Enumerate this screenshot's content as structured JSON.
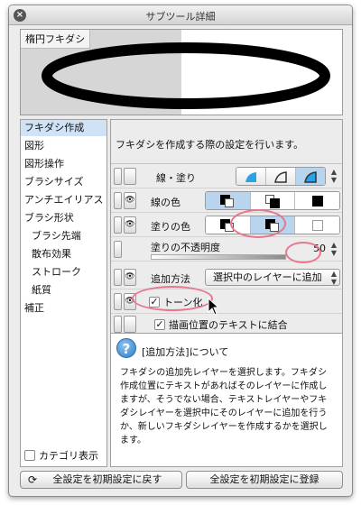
{
  "window": {
    "title": "サブツール詳細",
    "close_glyph": "×"
  },
  "preview": {
    "label": "楕円フキダシ"
  },
  "sidebar": {
    "items": [
      {
        "label": "フキダシ作成",
        "selected": true
      },
      {
        "label": "図形"
      },
      {
        "label": "図形操作"
      },
      {
        "label": "ブラシサイズ"
      },
      {
        "label": "アンチエイリアス"
      },
      {
        "label": "ブラシ形状"
      },
      {
        "label": "ブラシ先端",
        "sub": true
      },
      {
        "label": "散布効果",
        "sub": true
      },
      {
        "label": "ストローク",
        "sub": true
      },
      {
        "label": "紙質",
        "sub": true
      },
      {
        "label": "補正"
      }
    ],
    "category_checkbox_label": "カテゴリ表示"
  },
  "panel": {
    "description": "フキダシを作成する際の設定を行います。",
    "rows": {
      "stroke_fill": {
        "label": "線・塗り",
        "selected_index": 2
      },
      "line_color": {
        "label": "線の色",
        "selected_index": 0
      },
      "fill_color": {
        "label": "塗りの色",
        "selected_index": 1
      },
      "fill_opacity": {
        "label": "塗りの不透明度",
        "value": "50",
        "fill_fraction": 0.5
      },
      "add_method": {
        "label": "追加方法",
        "value": "選択中のレイヤーに追加"
      },
      "tone": {
        "label": "トーン化",
        "checked": true
      },
      "combine": {
        "label": "描画位置のテキストに結合",
        "checked": true
      }
    }
  },
  "help": {
    "icon": "question-icon",
    "title": "[追加方法]について",
    "body": "フキダシの追加先レイヤーを選択します。フキダシ作成位置にテキストがあればそのレイヤーに作成しますが、そうでない場合、テキストレイヤーやフキダシレイヤーを選択中にそのレイヤーに追加を行うか、新しいフキダシレイヤーを作成するかを選択します。"
  },
  "footer": {
    "reset_label": "全設定を初期設定に戻す",
    "register_label": "全設定を初期設定に登録"
  },
  "colors": {
    "accent": "#b9d4ee",
    "annotation": "#e8768f",
    "help_icon": "#2f7dc8"
  }
}
